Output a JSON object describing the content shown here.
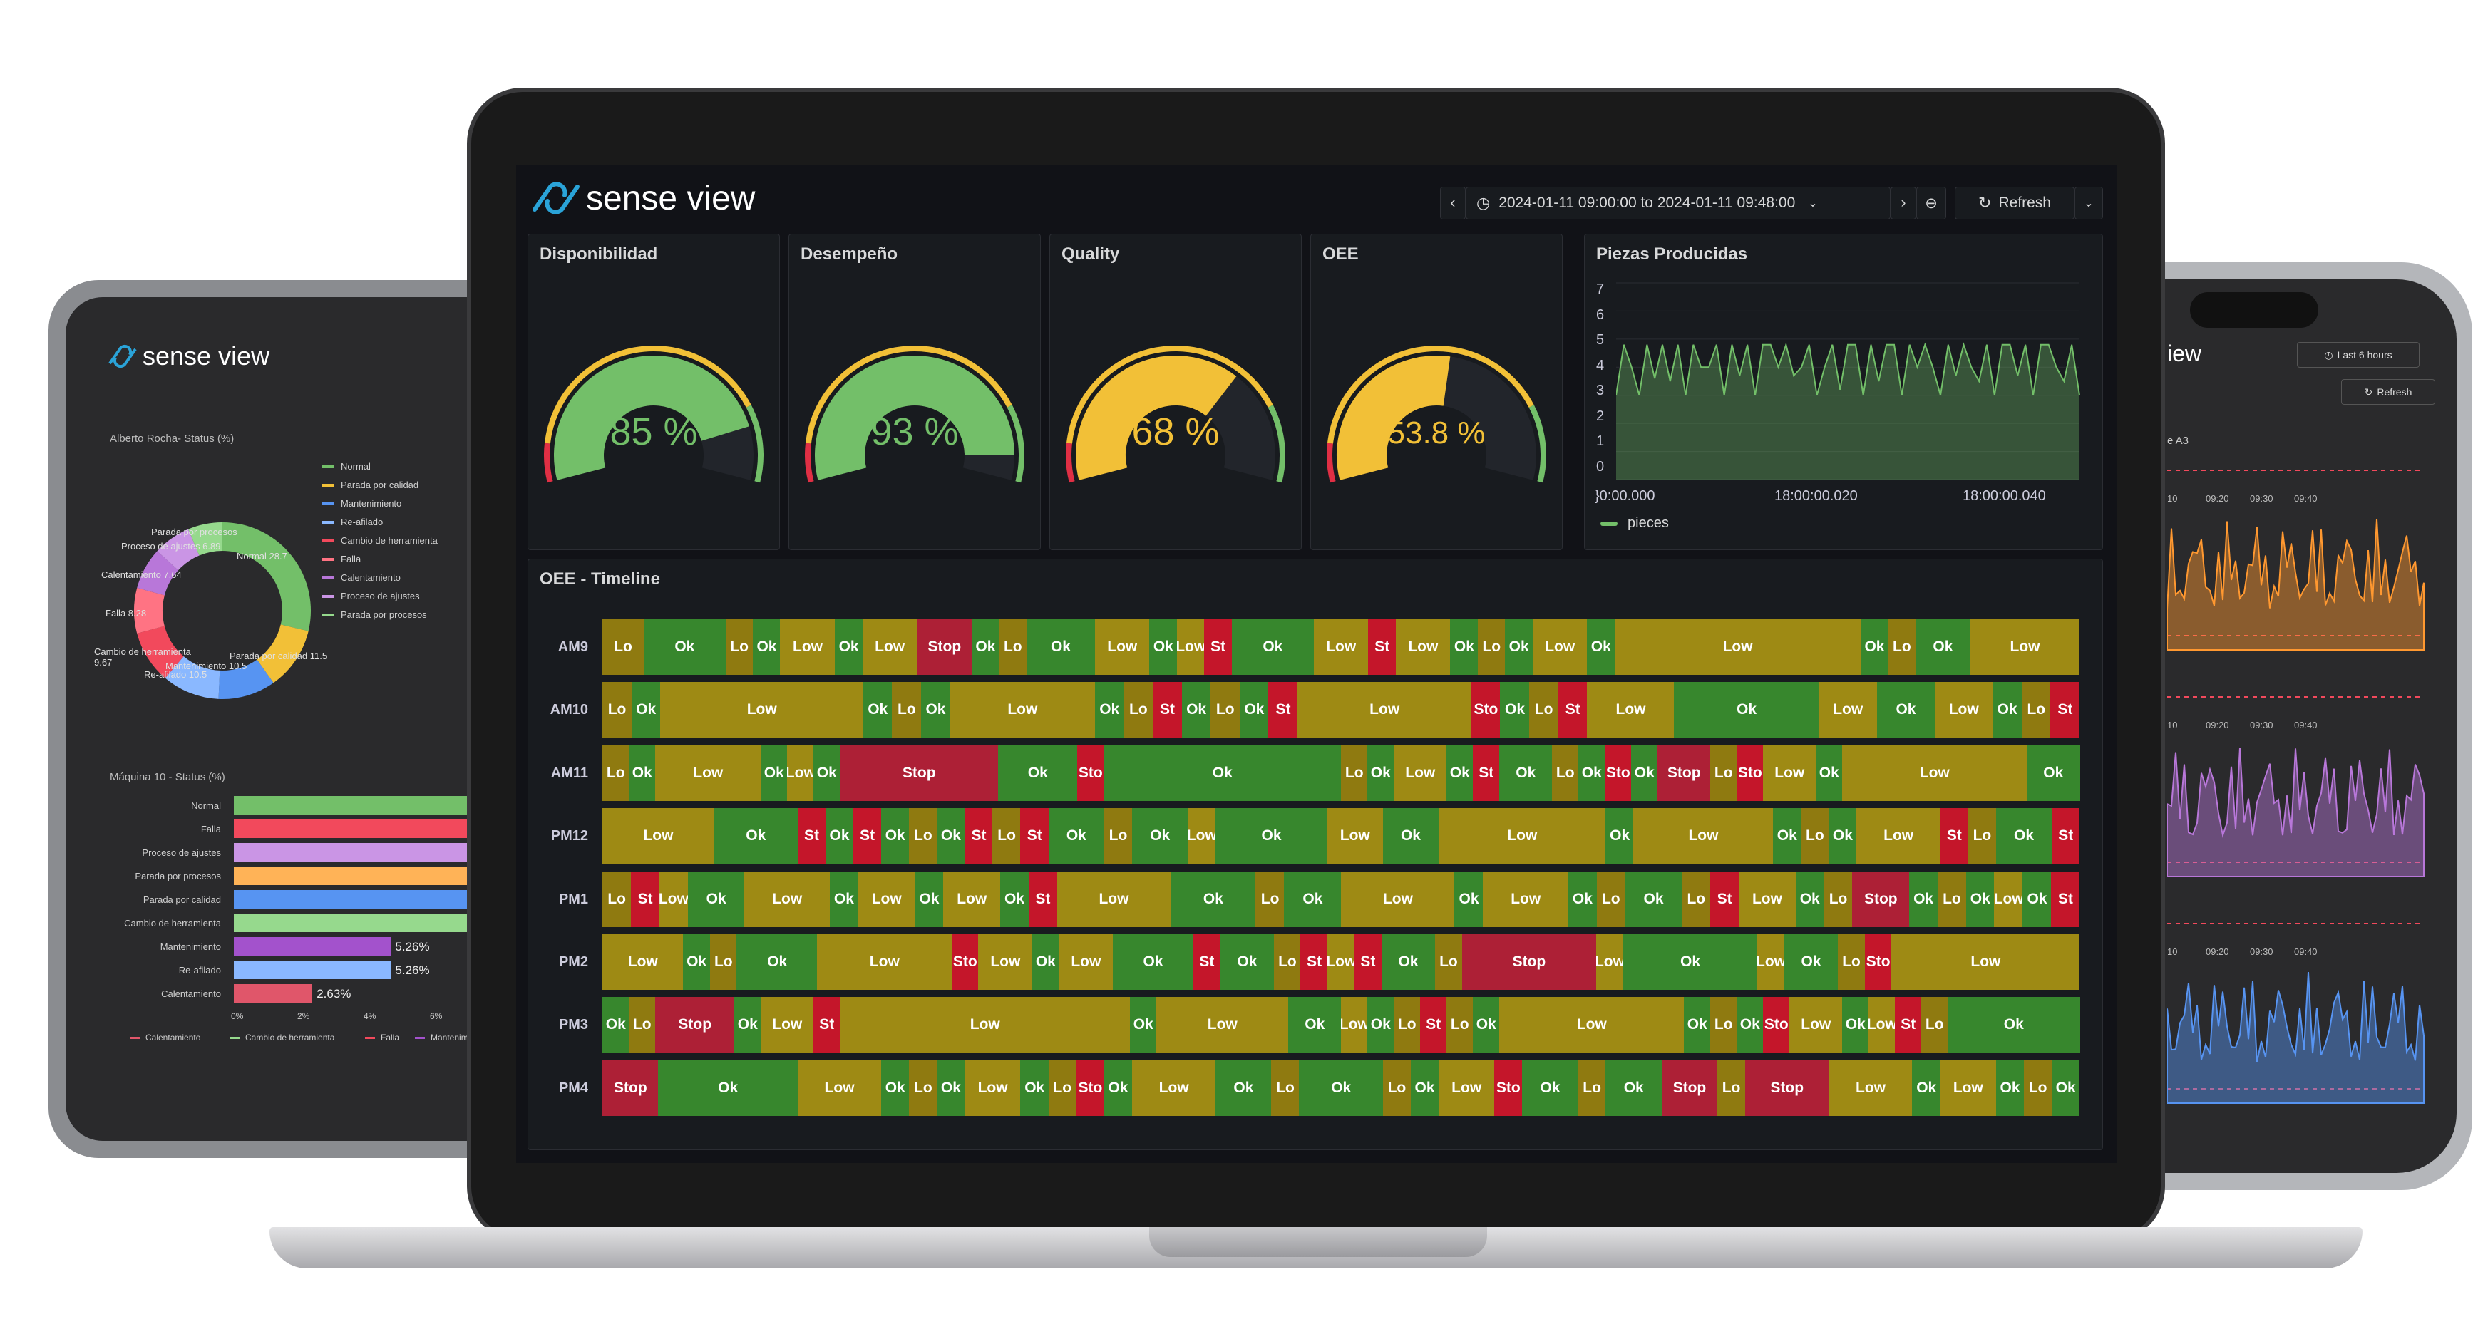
{
  "brand": {
    "name": "sense view"
  },
  "toolbar": {
    "prev": "‹",
    "time_range": "2024-01-11 09:00:00 to 2024-01-11 09:48:00",
    "next": "›",
    "refresh": "Refresh"
  },
  "gauges": [
    {
      "title": "Disponibilidad",
      "value": 85,
      "label": "85 %",
      "color": "#73bf69"
    },
    {
      "title": "Desempeño",
      "value": 93,
      "label": "93 %",
      "color": "#73bf69"
    },
    {
      "title": "Quality",
      "value": 68,
      "label": "68 %",
      "color": "#f2c037"
    },
    {
      "title": "OEE",
      "value": 53.8,
      "label": "53.8 %",
      "color": "#f2c037"
    }
  ],
  "pieces": {
    "title": "Piezas Producidas",
    "yticks": [
      "7",
      "6",
      "5",
      "4",
      "3",
      "2",
      "1",
      "0"
    ],
    "xticks": [
      "}0:00.000",
      "18:00:00.020",
      "18:00:00.040"
    ],
    "legend": "pieces",
    "color": "#73bf69"
  },
  "chart_data": {
    "type": "area",
    "title": "Piezas Producidas",
    "ylim": [
      0,
      7
    ],
    "series": [
      {
        "name": "pieces",
        "values": [
          3,
          4.8,
          4,
          3,
          4.8,
          3.6,
          4.8,
          3.5,
          4.8,
          3,
          4.8,
          4,
          4,
          4.8,
          3,
          4.8,
          3.7,
          4.8,
          3,
          4.8,
          4.8,
          4,
          4.8,
          3.7,
          4,
          4.8,
          3,
          4,
          4.8,
          3.2,
          4.8,
          4.8,
          3,
          4.8,
          3.5,
          4.8,
          4.8,
          3,
          4.8,
          4,
          4.8,
          4,
          3,
          4.8,
          3.7,
          4.8,
          4,
          3.5,
          4.8,
          3,
          4.8,
          4.8,
          3.7,
          4.8,
          3,
          4.8,
          4.8,
          4,
          3.5,
          4.8,
          3
        ]
      }
    ]
  },
  "timeline": {
    "title": "OEE - Timeline",
    "colors": {
      "Ok": "#37872d",
      "Lo": "#8f7a10",
      "Low": "#9e8a14",
      "St": "#c4162a",
      "Stop": "#ad2036",
      "Sto": "#c4162a"
    },
    "rows": [
      {
        "label": "AM9",
        "segs": [
          [
            "Lo",
            3
          ],
          [
            "Ok",
            6
          ],
          [
            "Lo",
            2
          ],
          [
            "Ok",
            2
          ],
          [
            "Low",
            4
          ],
          [
            "Ok",
            2
          ],
          [
            "Low",
            4
          ],
          [
            "Stop",
            4
          ],
          [
            "Ok",
            2
          ],
          [
            "Lo",
            2
          ],
          [
            "Ok",
            5
          ],
          [
            "Low",
            4
          ],
          [
            "Ok",
            2
          ],
          [
            "Low",
            2
          ],
          [
            "St",
            2
          ],
          [
            "Ok",
            6
          ],
          [
            "Low",
            4
          ],
          [
            "St",
            2
          ],
          [
            "Low",
            4
          ],
          [
            "Ok",
            2
          ],
          [
            "Lo",
            2
          ],
          [
            "Ok",
            2
          ],
          [
            "Low",
            4
          ],
          [
            "Ok",
            2
          ],
          [
            "Low",
            18
          ],
          [
            "Ok",
            2
          ],
          [
            "Lo",
            2
          ],
          [
            "Ok",
            4
          ],
          [
            "Low",
            8
          ]
        ]
      },
      {
        "label": "AM10",
        "segs": [
          [
            "Lo",
            2
          ],
          [
            "Ok",
            2
          ],
          [
            "Low",
            14
          ],
          [
            "Ok",
            2
          ],
          [
            "Lo",
            2
          ],
          [
            "Ok",
            2
          ],
          [
            "Low",
            10
          ],
          [
            "Ok",
            2
          ],
          [
            "Lo",
            2
          ],
          [
            "St",
            2
          ],
          [
            "Ok",
            2
          ],
          [
            "Lo",
            2
          ],
          [
            "Ok",
            2
          ],
          [
            "St",
            2
          ],
          [
            "Low",
            12
          ],
          [
            "Sto",
            2
          ],
          [
            "Ok",
            2
          ],
          [
            "Lo",
            2
          ],
          [
            "St",
            2
          ],
          [
            "Low",
            6
          ],
          [
            "Ok",
            10
          ],
          [
            "Low",
            4
          ],
          [
            "Ok",
            4
          ],
          [
            "Low",
            4
          ],
          [
            "Ok",
            2
          ],
          [
            "Lo",
            2
          ],
          [
            "St",
            2
          ]
        ]
      },
      {
        "label": "AM11",
        "segs": [
          [
            "Lo",
            2
          ],
          [
            "Ok",
            2
          ],
          [
            "Low",
            8
          ],
          [
            "Ok",
            2
          ],
          [
            "Low",
            2
          ],
          [
            "Ok",
            2
          ],
          [
            "Stop",
            12
          ],
          [
            "Ok",
            6
          ],
          [
            "Sto",
            2
          ],
          [
            "Ok",
            18
          ],
          [
            "Lo",
            2
          ],
          [
            "Ok",
            2
          ],
          [
            "Low",
            4
          ],
          [
            "Ok",
            2
          ],
          [
            "St",
            2
          ],
          [
            "Ok",
            4
          ],
          [
            "Lo",
            2
          ],
          [
            "Ok",
            2
          ],
          [
            "Sto",
            2
          ],
          [
            "Ok",
            2
          ],
          [
            "Stop",
            4
          ],
          [
            "Lo",
            2
          ],
          [
            "Sto",
            2
          ],
          [
            "Low",
            4
          ],
          [
            "Ok",
            2
          ],
          [
            "Low",
            14
          ],
          [
            "Ok",
            4
          ]
        ]
      },
      {
        "label": "PM12",
        "segs": [
          [
            "Low",
            8
          ],
          [
            "Ok",
            6
          ],
          [
            "St",
            2
          ],
          [
            "Ok",
            2
          ],
          [
            "St",
            2
          ],
          [
            "Ok",
            2
          ],
          [
            "Lo",
            2
          ],
          [
            "Ok",
            2
          ],
          [
            "St",
            2
          ],
          [
            "Lo",
            2
          ],
          [
            "St",
            2
          ],
          [
            "Ok",
            4
          ],
          [
            "Lo",
            2
          ],
          [
            "Ok",
            4
          ],
          [
            "Low",
            2
          ],
          [
            "Ok",
            8
          ],
          [
            "Low",
            4
          ],
          [
            "Ok",
            4
          ],
          [
            "Low",
            12
          ],
          [
            "Ok",
            2
          ],
          [
            "Low",
            10
          ],
          [
            "Ok",
            2
          ],
          [
            "Lo",
            2
          ],
          [
            "Ok",
            2
          ],
          [
            "Low",
            6
          ],
          [
            "St",
            2
          ],
          [
            "Lo",
            2
          ],
          [
            "Ok",
            4
          ],
          [
            "St",
            2
          ]
        ]
      },
      {
        "label": "PM1",
        "segs": [
          [
            "Lo",
            2
          ],
          [
            "St",
            2
          ],
          [
            "Low",
            2
          ],
          [
            "Ok",
            4
          ],
          [
            "Low",
            6
          ],
          [
            "Ok",
            2
          ],
          [
            "Low",
            4
          ],
          [
            "Ok",
            2
          ],
          [
            "Low",
            4
          ],
          [
            "Ok",
            2
          ],
          [
            "St",
            2
          ],
          [
            "Low",
            8
          ],
          [
            "Ok",
            6
          ],
          [
            "Lo",
            2
          ],
          [
            "Ok",
            4
          ],
          [
            "Low",
            8
          ],
          [
            "Ok",
            2
          ],
          [
            "Low",
            6
          ],
          [
            "Ok",
            2
          ],
          [
            "Lo",
            2
          ],
          [
            "Ok",
            4
          ],
          [
            "Lo",
            2
          ],
          [
            "St",
            2
          ],
          [
            "Low",
            4
          ],
          [
            "Ok",
            2
          ],
          [
            "Lo",
            2
          ],
          [
            "Stop",
            4
          ],
          [
            "Ok",
            2
          ],
          [
            "Lo",
            2
          ],
          [
            "Ok",
            2
          ],
          [
            "Low",
            2
          ],
          [
            "Ok",
            2
          ],
          [
            "St",
            2
          ]
        ]
      },
      {
        "label": "PM2",
        "segs": [
          [
            "Low",
            6
          ],
          [
            "Ok",
            2
          ],
          [
            "Lo",
            2
          ],
          [
            "Ok",
            6
          ],
          [
            "Low",
            10
          ],
          [
            "Sto",
            2
          ],
          [
            "Low",
            4
          ],
          [
            "Ok",
            2
          ],
          [
            "Low",
            4
          ],
          [
            "Ok",
            6
          ],
          [
            "St",
            2
          ],
          [
            "Ok",
            4
          ],
          [
            "Lo",
            2
          ],
          [
            "St",
            2
          ],
          [
            "Low",
            2
          ],
          [
            "St",
            2
          ],
          [
            "Ok",
            4
          ],
          [
            "Lo",
            2
          ],
          [
            "Stop",
            10
          ],
          [
            "Low",
            2
          ],
          [
            "Ok",
            10
          ],
          [
            "Low",
            2
          ],
          [
            "Ok",
            4
          ],
          [
            "Lo",
            2
          ],
          [
            "Sto",
            2
          ],
          [
            "Low",
            14
          ]
        ]
      },
      {
        "label": "PM3",
        "segs": [
          [
            "Ok",
            2
          ],
          [
            "Lo",
            2
          ],
          [
            "Stop",
            6
          ],
          [
            "Ok",
            2
          ],
          [
            "Low",
            4
          ],
          [
            "St",
            2
          ],
          [
            "Low",
            22
          ],
          [
            "Ok",
            2
          ],
          [
            "Low",
            10
          ],
          [
            "Ok",
            4
          ],
          [
            "Low",
            2
          ],
          [
            "Ok",
            2
          ],
          [
            "Lo",
            2
          ],
          [
            "St",
            2
          ],
          [
            "Lo",
            2
          ],
          [
            "Ok",
            2
          ],
          [
            "Low",
            14
          ],
          [
            "Ok",
            2
          ],
          [
            "Lo",
            2
          ],
          [
            "Ok",
            2
          ],
          [
            "Sto",
            2
          ],
          [
            "Low",
            4
          ],
          [
            "Ok",
            2
          ],
          [
            "Low",
            2
          ],
          [
            "St",
            2
          ],
          [
            "Lo",
            2
          ],
          [
            "Ok",
            10
          ]
        ]
      },
      {
        "label": "PM4",
        "segs": [
          [
            "Stop",
            4
          ],
          [
            "Ok",
            10
          ],
          [
            "Low",
            6
          ],
          [
            "Ok",
            2
          ],
          [
            "Lo",
            2
          ],
          [
            "Ok",
            2
          ],
          [
            "Low",
            4
          ],
          [
            "Ok",
            2
          ],
          [
            "Lo",
            2
          ],
          [
            "Sto",
            2
          ],
          [
            "Ok",
            2
          ],
          [
            "Low",
            6
          ],
          [
            "Ok",
            4
          ],
          [
            "Lo",
            2
          ],
          [
            "Ok",
            6
          ],
          [
            "Lo",
            2
          ],
          [
            "Ok",
            2
          ],
          [
            "Low",
            4
          ],
          [
            "Sto",
            2
          ],
          [
            "Ok",
            4
          ],
          [
            "Lo",
            2
          ],
          [
            "Ok",
            4
          ],
          [
            "Stop",
            4
          ],
          [
            "Lo",
            2
          ],
          [
            "Stop",
            6
          ],
          [
            "Low",
            6
          ],
          [
            "Ok",
            2
          ],
          [
            "Low",
            4
          ],
          [
            "Ok",
            2
          ],
          [
            "Lo",
            2
          ],
          [
            "Ok",
            2
          ]
        ]
      }
    ]
  },
  "tablet": {
    "brand": "sense view",
    "pie_title": "Alberto Rocha- Status (%)",
    "pie_legend": [
      "Normal",
      "Parada por calidad",
      "Mantenimiento",
      "Re-afilado",
      "Cambio de herramienta",
      "Falla",
      "Calentamiento",
      "Proceso de ajustes",
      "Parada por procesos"
    ],
    "pie_legend_colors": [
      "#73bf69",
      "#f2c037",
      "#5794f2",
      "#8ab8ff",
      "#f2495c",
      "#ff7383",
      "#b877d9",
      "#ca95e5",
      "#96d98d"
    ],
    "pie_labels": [
      "Parada por procesos",
      "Proceso de ajustes 6.89",
      "Calentamiento 7.64",
      "Falla 8.28",
      "Cambio de herramienta 9.67",
      "Re-afilado 10.5",
      "Mantenimiento 10.5",
      "Parada por calidad 11.5",
      "Normal 28.7"
    ],
    "bar_title": "Máquina 10 - Status (%)",
    "bar_labels": [
      "Normal",
      "Falla",
      "Proceso de ajustes",
      "Parada por procesos",
      "Parada por calidad",
      "Cambio de herramienta",
      "Mantenimiento",
      "Re-afilado",
      "Calentamiento"
    ],
    "bar_colors": [
      "#73bf69",
      "#f2495c",
      "#ca95e5",
      "#ffb357",
      "#5794f2",
      "#96d98d",
      "#a352cc",
      "#8ab8ff",
      "#e0566a"
    ],
    "bar_values": [
      "",
      "",
      "",
      "",
      "",
      "",
      "5.26%",
      "5.26%",
      "2.63%"
    ],
    "bar_axis": [
      "0%",
      "2%",
      "4%",
      "6%"
    ],
    "bar_legend": [
      "Calentamiento",
      "Cambio de herramienta",
      "Falla",
      "Mantenimien"
    ]
  },
  "phone": {
    "title": "iew",
    "time": "Last 6 hours",
    "refresh": "Refresh",
    "panel_title": "e A3",
    "xticks": [
      "10",
      "09:20",
      "09:30",
      "09:40"
    ]
  }
}
